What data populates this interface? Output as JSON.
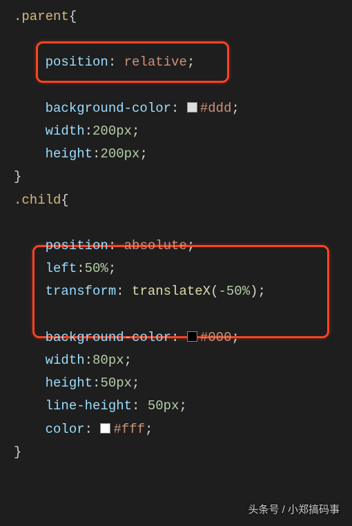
{
  "code": {
    "parent": {
      "selector": ".parent",
      "position_prop": "position",
      "position_val": "relative",
      "bg_prop": "background-color",
      "bg_val": "#ddd",
      "width_prop": "width",
      "width_val": "200px",
      "height_prop": "height",
      "height_val": "200px"
    },
    "child": {
      "selector": ".child",
      "position_prop": "position",
      "position_val": "absolute",
      "left_prop": "left",
      "left_val": "50%",
      "transform_prop": "transform",
      "transform_func": "translateX",
      "transform_arg": "-50%",
      "bg_prop": "background-color",
      "bg_val": "#000",
      "width_prop": "width",
      "width_val": "80px",
      "height_prop": "height",
      "height_val": "50px",
      "lh_prop": "line-height",
      "lh_val": "50px",
      "color_prop": "color",
      "color_val": "#fff"
    },
    "open_brace": "{",
    "close_brace": "}",
    "colon": ":",
    "semi": ";",
    "paren_open": "(",
    "paren_close": ")"
  },
  "watermark": "头条号 / 小郑搞码事"
}
